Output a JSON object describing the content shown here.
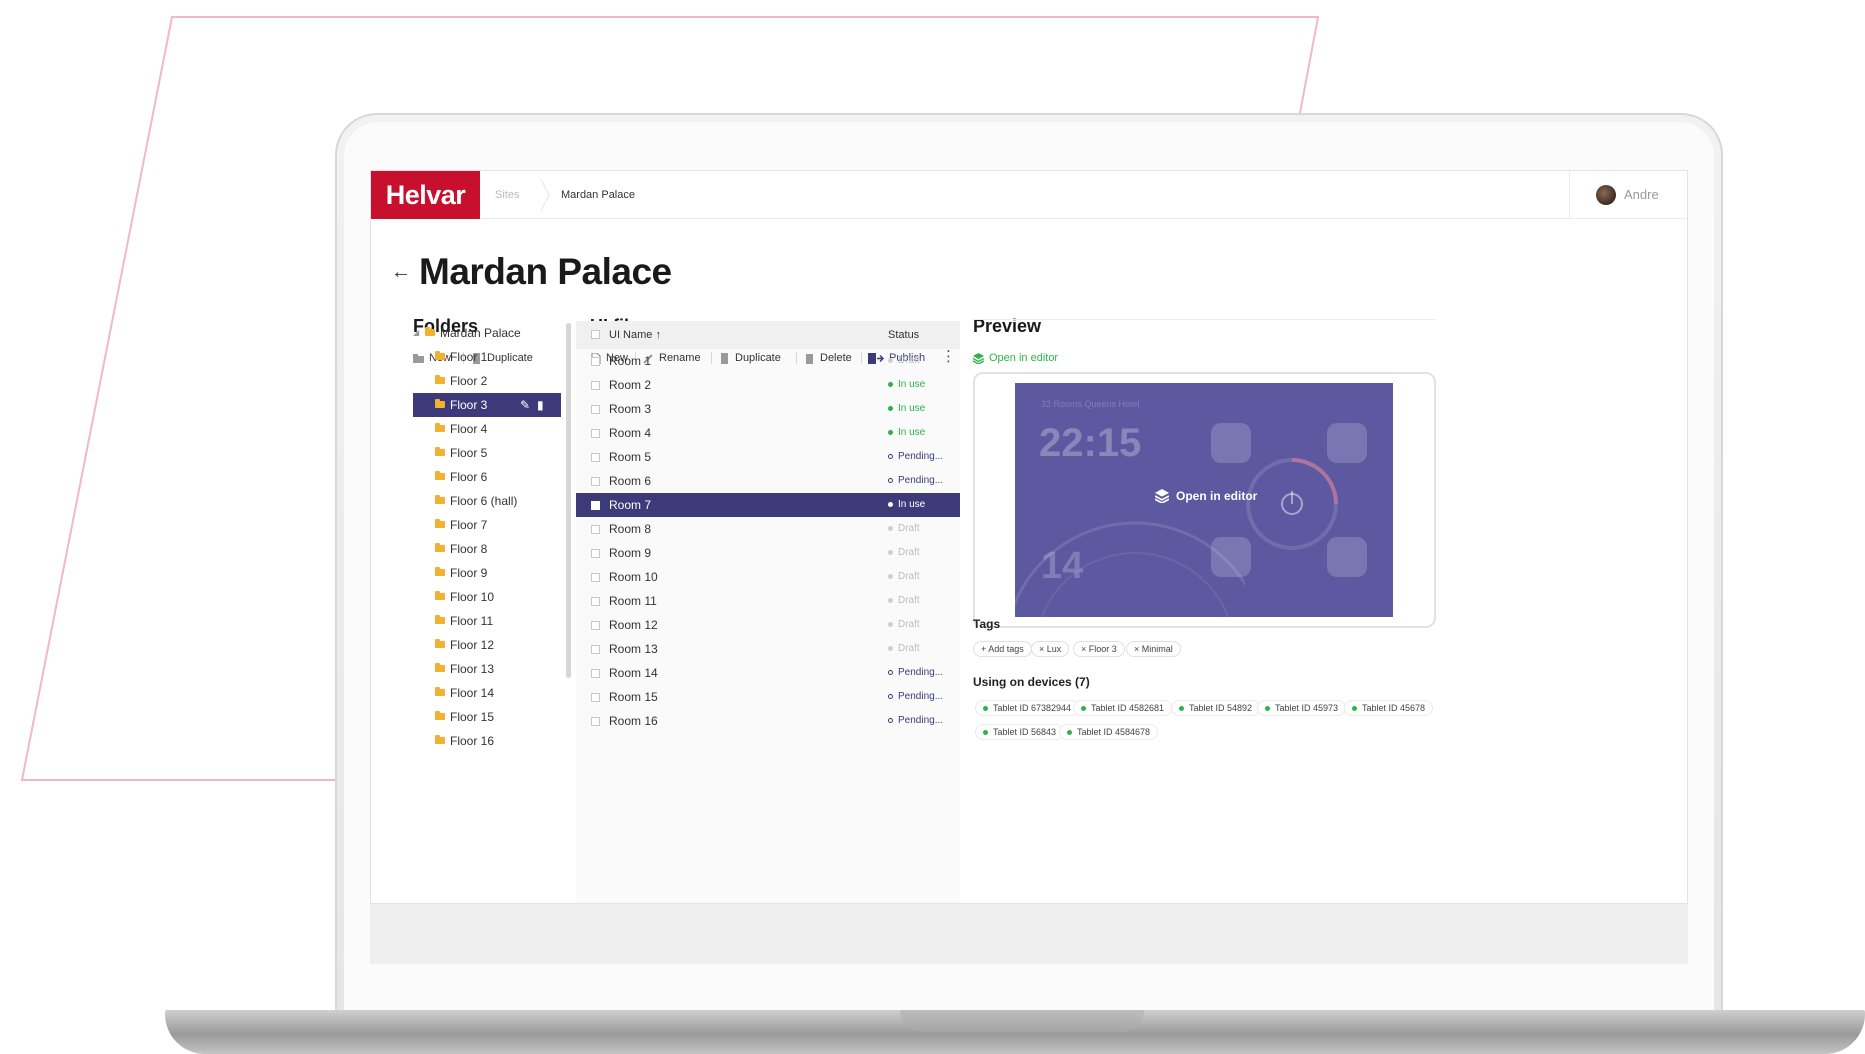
{
  "app": {
    "logo": "Helvar",
    "breadcrumb": [
      "Sites",
      "Mardan Palace"
    ],
    "user": "Andre"
  },
  "page": {
    "back_icon": "arrow-left-icon",
    "title": "Mardan Palace"
  },
  "folders": {
    "title": "Folders",
    "toolbar": {
      "new": "New",
      "duplicate": "Duplicate"
    },
    "root": "Mardan Palace",
    "items": [
      "Floor 1",
      "Floor 2",
      "Floor 3",
      "Floor 4",
      "Floor 5",
      "Floor 6",
      "Floor 6 (hall)",
      "Floor 7",
      "Floor 8",
      "Floor 9",
      "Floor 10",
      "Floor 11",
      "Floor 12",
      "Floor 13",
      "Floor 14",
      "Floor 15",
      "Floor 16"
    ],
    "selected": "Floor 3"
  },
  "ui_files": {
    "title": "UI files",
    "toolbar": {
      "new": "New",
      "rename": "Rename",
      "duplicate": "Duplicate",
      "delete": "Delete",
      "publish": "Publish"
    },
    "columns": {
      "name": "UI Name",
      "sort": "↑",
      "status": "Status"
    },
    "rows": [
      {
        "name": "Room 1",
        "status": "Draft",
        "state": "draft"
      },
      {
        "name": "Room 2",
        "status": "In use",
        "state": "inuse"
      },
      {
        "name": "Room 3",
        "status": "In use",
        "state": "inuse"
      },
      {
        "name": "Room 4",
        "status": "In use",
        "state": "inuse"
      },
      {
        "name": "Room 5",
        "status": "Pending...",
        "state": "pending"
      },
      {
        "name": "Room 6",
        "status": "Pending...",
        "state": "pending"
      },
      {
        "name": "Room 7",
        "status": "In use",
        "state": "inuse"
      },
      {
        "name": "Room 8",
        "status": "Draft",
        "state": "draft"
      },
      {
        "name": "Room 9",
        "status": "Draft",
        "state": "draft"
      },
      {
        "name": "Room 10",
        "status": "Draft",
        "state": "draft"
      },
      {
        "name": "Room 11",
        "status": "Draft",
        "state": "draft"
      },
      {
        "name": "Room 12",
        "status": "Draft",
        "state": "draft"
      },
      {
        "name": "Room 13",
        "status": "Draft",
        "state": "draft"
      },
      {
        "name": "Room 14",
        "status": "Pending...",
        "state": "pending"
      },
      {
        "name": "Room 15",
        "status": "Pending...",
        "state": "pending"
      },
      {
        "name": "Room 16",
        "status": "Pending...",
        "state": "pending"
      }
    ],
    "selected": "Room 7"
  },
  "preview": {
    "title": "Preview",
    "open_link": "Open in editor",
    "overlay_label": "Open in editor",
    "screen_time": "22:15",
    "screen_temp": "14",
    "screen_caption": "32 Rooms Queens Hotel",
    "tags_title": "Tags",
    "tags": [
      "+ Add tags",
      "× Lux",
      "× Floor 3",
      "× Minimal"
    ],
    "devices_title": "Using on devices (7)",
    "devices": [
      "Tablet ID 67382944",
      "Tablet ID 4582681",
      "Tablet ID 54892",
      "Tablet ID 45973",
      "Tablet ID 45678",
      "Tablet ID 56843",
      "Tablet ID 4584678"
    ]
  },
  "colors": {
    "brand": "#c8102e",
    "selection": "#3d3a7a",
    "in_use": "#2db34a",
    "folder": "#f2b230",
    "preview_bg": "#5c59a0"
  }
}
